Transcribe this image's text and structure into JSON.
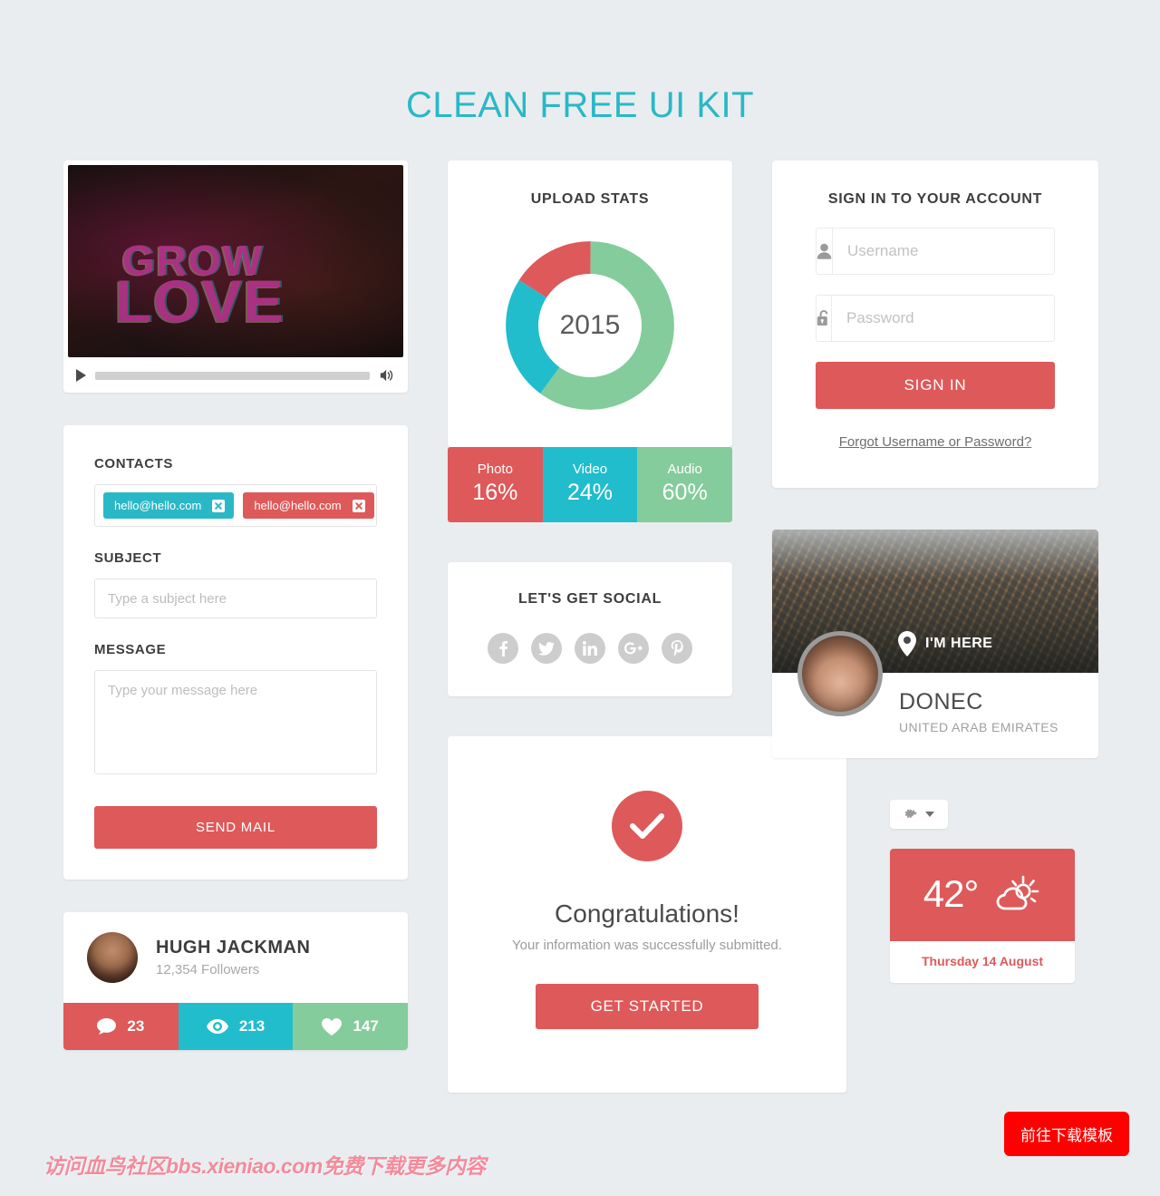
{
  "page": {
    "title": "CLEAN FREE UI KIT",
    "title_color": "#2ab8c6",
    "background": "#e9edf0"
  },
  "theme": {
    "red": "#de5959",
    "teal": "#21bdcc",
    "green": "#84cc9b",
    "text_dark": "#3d3d3d",
    "text_muted": "#a8a8a8"
  },
  "video_player": {
    "overlay_line1": "GROW",
    "overlay_line2": "LOVE",
    "play_icon": "play-icon",
    "volume_icon": "volume-icon",
    "progress_percent": 0
  },
  "contact_form": {
    "contacts_label": "CONTACTS",
    "tags": [
      {
        "email": "hello@hello.com",
        "color": "teal"
      },
      {
        "email": "hello@hello.com",
        "color": "red"
      }
    ],
    "subject_label": "SUBJECT",
    "subject_placeholder": "Type a subject here",
    "subject_value": "",
    "message_label": "MESSAGE",
    "message_placeholder": "Type your message here",
    "message_value": "",
    "send_button": "SEND MAIL"
  },
  "person_card": {
    "name": "HUGH JACKMAN",
    "followers": "12,354 Followers",
    "avatar_icon": "avatar",
    "stats": [
      {
        "icon": "comment-icon",
        "value": "23",
        "color": "red"
      },
      {
        "icon": "eye-icon",
        "value": "213",
        "color": "teal"
      },
      {
        "icon": "heart-icon",
        "value": "147",
        "color": "green"
      }
    ]
  },
  "upload_stats": {
    "heading": "UPLOAD STATS",
    "center_label": "2015"
  },
  "chart_data": {
    "type": "pie",
    "title": "UPLOAD STATS",
    "center_label": "2015",
    "categories": [
      "Photo",
      "Video",
      "Audio"
    ],
    "values": [
      16,
      24,
      60
    ],
    "value_labels": [
      "16%",
      "24%",
      "60%"
    ],
    "colors": [
      "#de5959",
      "#21bdcc",
      "#84cc9b"
    ],
    "donut": true,
    "inner_radius_ratio": 0.58,
    "start_angle_deg": 0,
    "direction": "clockwise",
    "units": "percent",
    "legend": "below-as-bar",
    "grid": false
  },
  "social_card": {
    "heading": "LET'S GET SOCIAL",
    "icons": [
      {
        "name": "facebook-icon",
        "glyph": "f"
      },
      {
        "name": "twitter-icon",
        "glyph": "t"
      },
      {
        "name": "linkedin-icon",
        "glyph": "in"
      },
      {
        "name": "googleplus-icon",
        "glyph": "g+"
      },
      {
        "name": "pinterest-icon",
        "glyph": "p"
      }
    ]
  },
  "congrats_card": {
    "check_icon": "check-icon",
    "title": "Congratulations!",
    "subtitle": "Your information was successfully submitted.",
    "button": "GET STARTED"
  },
  "signin_card": {
    "heading": "SIGN IN TO YOUR ACCOUNT",
    "username_placeholder": "Username",
    "username_value": "",
    "username_icon": "user-icon",
    "password_placeholder": "Password",
    "password_value": "",
    "password_icon": "lock-icon",
    "button": "SIGN IN",
    "forgot_link": "Forgot Username or Password?"
  },
  "location_card": {
    "pin_icon": "map-pin-icon",
    "pin_text": "I'M HERE",
    "name": "DONEC",
    "country": "UNITED ARAB EMIRATES",
    "avatar_icon": "avatar"
  },
  "weather": {
    "gear_icon": "gear-icon",
    "caret_icon": "chevron-down-icon",
    "temperature": "42°",
    "condition_icon": "sun-behind-cloud-icon",
    "date": "Thursday 14 August"
  },
  "footer": {
    "watermark": "访问血鸟社区bbs.xieniao.com免费下载更多内容",
    "download_button": "前往下载模板"
  }
}
